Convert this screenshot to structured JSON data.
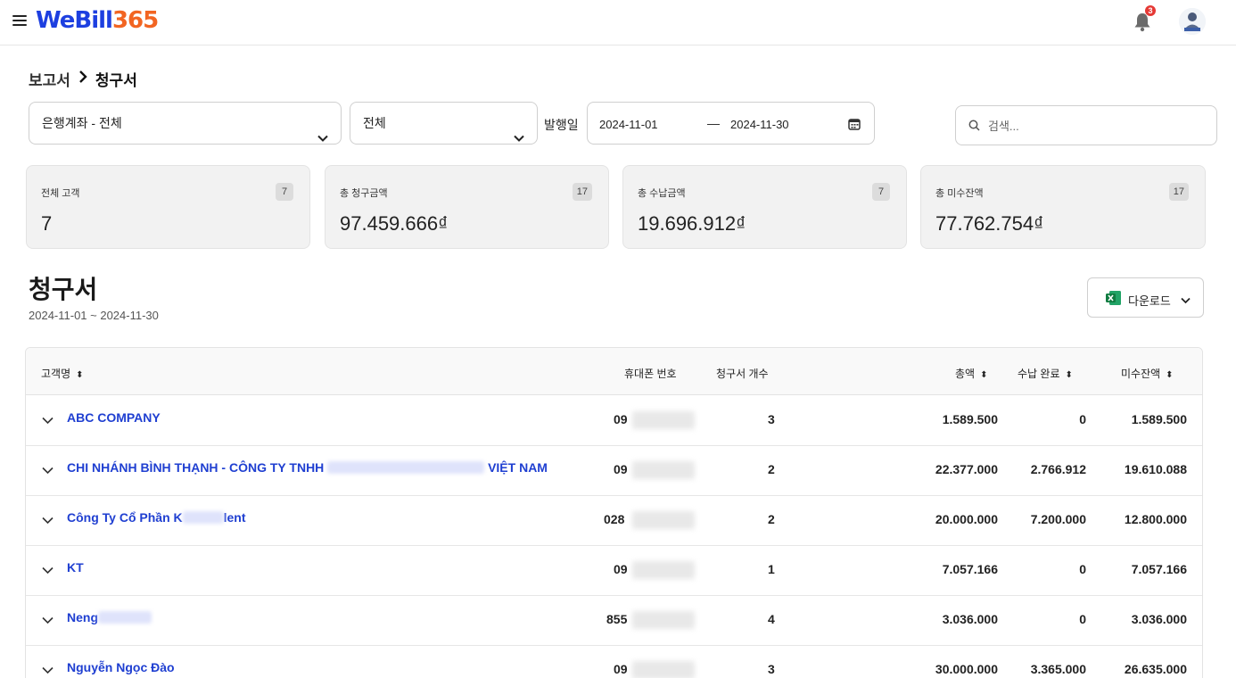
{
  "header": {
    "logo_we": "WeBill",
    "logo_365": "365",
    "notification_count": "3"
  },
  "breadcrumb": {
    "parent": "보고서",
    "current": "청구서"
  },
  "filters": {
    "bank_account": "은행계좌 - 전체",
    "status": "전체",
    "date_label": "발행일",
    "date_from": "2024-11-01",
    "date_sep": "—",
    "date_to": "2024-11-30",
    "search_placeholder": "검색..."
  },
  "stats": [
    {
      "label": "전체 고객",
      "count": "7",
      "value": "7"
    },
    {
      "label": "총 청구금액",
      "count": "17",
      "value": "97.459.666₫"
    },
    {
      "label": "총 수납금액",
      "count": "7",
      "value": "19.696.912₫"
    },
    {
      "label": "총 미수잔액",
      "count": "17",
      "value": "77.762.754₫"
    }
  ],
  "section": {
    "title": "청구서",
    "subtitle": "2024-11-01 ~ 2024-11-30",
    "download_label": "다운로드"
  },
  "table": {
    "columns": {
      "customer": "고객명",
      "phone": "휴대폰 번호",
      "invoice_count": "청구서 개수",
      "total": "총액",
      "paid": "수납 완료",
      "outstanding": "미수잔액"
    },
    "rows": [
      {
        "name_a": "ABC COMPANY",
        "name_b": "",
        "phone": "09",
        "count": "3",
        "total": "1.589.500",
        "paid": "0",
        "outstanding": "1.589.500"
      },
      {
        "name_a": "CHI NHÁNH BÌNH THẠNH - CÔNG TY TNHH",
        "name_b": "VIỆT NAM",
        "phone": "09",
        "count": "2",
        "total": "22.377.000",
        "paid": "2.766.912",
        "outstanding": "19.610.088"
      },
      {
        "name_a": "Công Ty Cổ Phần K",
        "name_b": "lent",
        "phone": "028",
        "count": "2",
        "total": "20.000.000",
        "paid": "7.200.000",
        "outstanding": "12.800.000"
      },
      {
        "name_a": "KT",
        "name_b": "",
        "phone": "09",
        "count": "1",
        "total": "7.057.166",
        "paid": "0",
        "outstanding": "7.057.166"
      },
      {
        "name_a": "Neng",
        "name_b": "",
        "phone": "855",
        "count": "4",
        "total": "3.036.000",
        "paid": "0",
        "outstanding": "3.036.000"
      },
      {
        "name_a": "Nguyễn Ngọc Đào",
        "name_b": "",
        "phone": "09",
        "count": "3",
        "total": "30.000.000",
        "paid": "3.365.000",
        "outstanding": "26.635.000"
      }
    ]
  },
  "icons": {
    "menu": "hamburger-icon",
    "bell": "bell-icon",
    "chevron": "chevron-down-icon",
    "calendar": "calendar-icon",
    "search": "search-icon",
    "excel": "excel-icon",
    "sort": "sort-icon"
  },
  "colors": {
    "brand_blue": "#1d3fe0",
    "brand_orange": "#f26522",
    "link": "#1f3fd1",
    "badge": "#e53935"
  }
}
